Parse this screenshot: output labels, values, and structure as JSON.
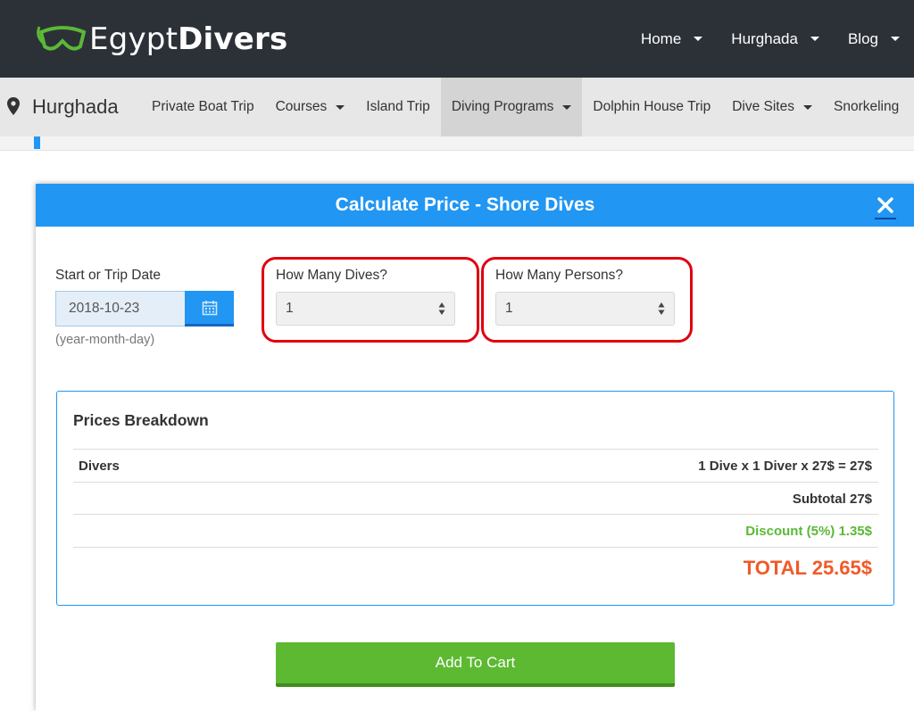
{
  "brand": {
    "prefix": "Egypt",
    "suffix": "Divers",
    "accent": "#5cb837"
  },
  "topnav": [
    {
      "label": "Home"
    },
    {
      "label": "Hurghada"
    },
    {
      "label": "Blog"
    }
  ],
  "subnav": {
    "city": "Hurghada",
    "items": [
      {
        "label": "Private Boat Trip",
        "dropdown": false
      },
      {
        "label": "Courses",
        "dropdown": true
      },
      {
        "label": "Island Trip",
        "dropdown": false
      },
      {
        "label": "Diving Programs",
        "dropdown": true,
        "active": true
      },
      {
        "label": "Dolphin House Trip",
        "dropdown": false
      },
      {
        "label": "Dive Sites",
        "dropdown": true
      },
      {
        "label": "Snorkeling",
        "dropdown": false
      }
    ]
  },
  "modal": {
    "title": "Calculate Price - Shore Dives",
    "date": {
      "label": "Start or Trip Date",
      "value": "2018-10-23",
      "hint": "(year-month-day)"
    },
    "dives": {
      "label": "How Many Dives?",
      "value": "1"
    },
    "persons": {
      "label": "How Many Persons?",
      "value": "1"
    },
    "breakdown": {
      "title": "Prices Breakdown",
      "divers_label": "Divers",
      "divers_calc": "1 Dive x 1 Diver x 27$ = 27$",
      "subtotal": "Subtotal 27$",
      "discount": "Discount (5%) 1.35$",
      "total": "TOTAL 25.65$"
    },
    "add_to_cart": "Add To Cart"
  },
  "colors": {
    "header": "#2c3138",
    "primary": "#2196f3",
    "highlight": "#e0000f",
    "discount": "#5cb837",
    "total": "#f05a28",
    "cart": "#5cb931"
  }
}
